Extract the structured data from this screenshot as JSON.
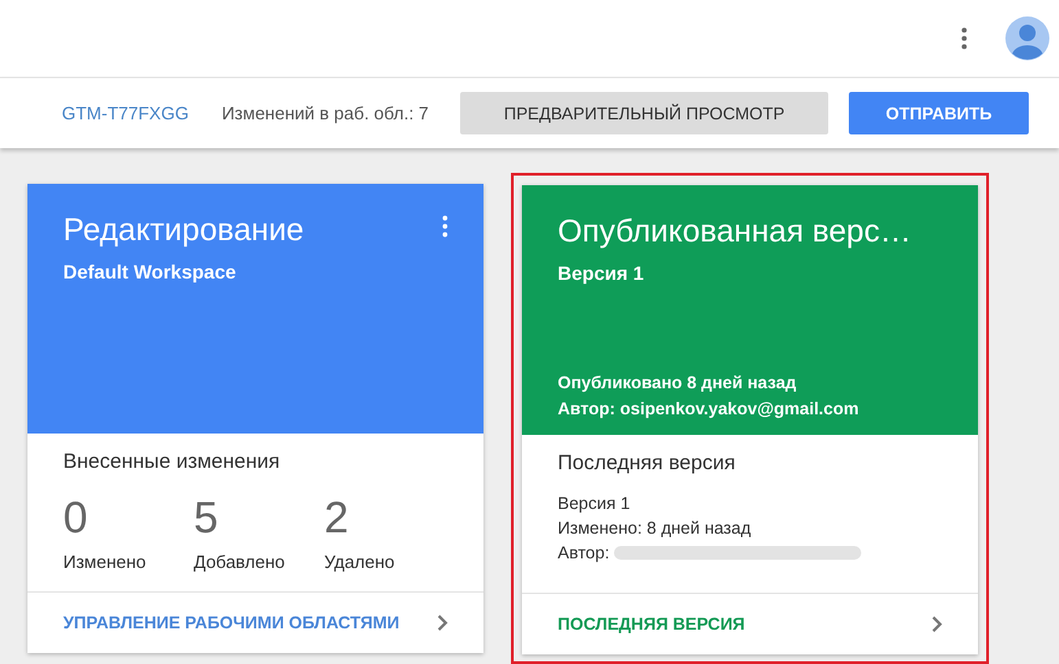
{
  "toolbar": {
    "container_id": "GTM-T77FXGG",
    "changes": "Изменений в раб. обл.: 7",
    "preview_button": "ПРЕДВАРИТЕЛЬНЫЙ ПРОСМОТР",
    "submit_button": "ОТПРАВИТЬ"
  },
  "workspace_card": {
    "title": "Редактирование",
    "subtitle": "Default Workspace",
    "section_title": "Внесенные изменения",
    "stats": [
      {
        "value": "0",
        "label": "Изменено"
      },
      {
        "value": "5",
        "label": "Добавлено"
      },
      {
        "value": "2",
        "label": "Удалено"
      }
    ],
    "link": "УПРАВЛЕНИЕ РАБОЧИМИ ОБЛАСТЯМИ"
  },
  "published_card": {
    "highlighted": true,
    "title": "Опубликованная верс…",
    "subtitle": "Версия 1",
    "published": "Опубликовано 8 дней назад",
    "author": "Автор: osipenkov.yakov@gmail.com",
    "section_title": "Последняя версия",
    "details": [
      "Версия 1",
      "Изменено: 8 дней назад",
      "Автор:"
    ],
    "link": "ПОСЛЕДНЯЯ ВЕРСИЯ"
  }
}
